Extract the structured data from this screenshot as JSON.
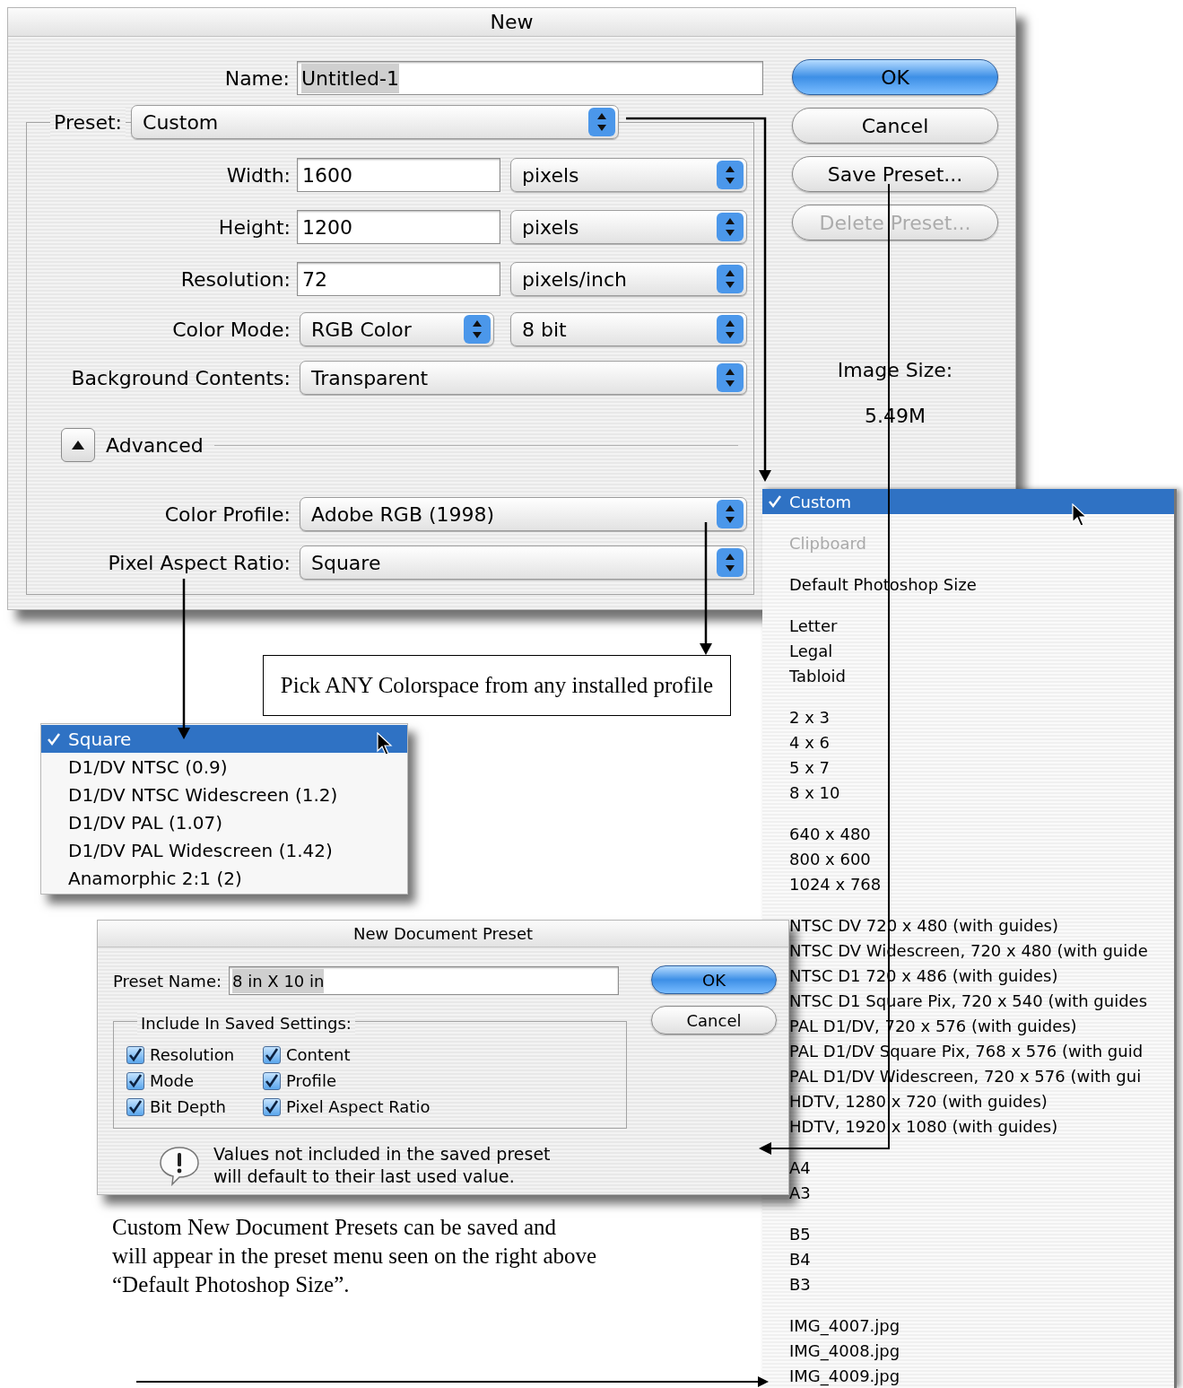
{
  "new_dialog": {
    "title": "New",
    "name": {
      "label": "Name:",
      "value": "Untitled-1",
      "selected": true
    },
    "preset": {
      "label": "Preset:",
      "value": "Custom"
    },
    "fields": [
      {
        "kind": "text",
        "label": "Width:",
        "value": "1600",
        "unit": "pixels"
      },
      {
        "kind": "text",
        "label": "Height:",
        "value": "1200",
        "unit": "pixels"
      },
      {
        "kind": "text",
        "label": "Resolution:",
        "value": "72",
        "unit": "pixels/inch"
      },
      {
        "kind": "popup_pair",
        "label": "Color Mode:",
        "value": "RGB Color",
        "unit": "8 bit"
      },
      {
        "kind": "popup",
        "label": "Background Contents:",
        "value": "Transparent"
      }
    ],
    "advanced": {
      "label": "Advanced",
      "expanded": true
    },
    "advanced_fields": [
      {
        "kind": "popup",
        "label": "Color Profile:",
        "value": "Adobe RGB (1998)"
      },
      {
        "kind": "popup",
        "label": "Pixel Aspect Ratio:",
        "value": "Square"
      }
    ],
    "buttons": [
      {
        "label": "OK",
        "default": true,
        "disabled": false
      },
      {
        "label": "Cancel",
        "default": false,
        "disabled": false
      },
      {
        "label": "Save Preset...",
        "default": false,
        "disabled": false
      },
      {
        "label": "Delete Preset...",
        "default": false,
        "disabled": true
      }
    ],
    "image_size": {
      "label": "Image Size:",
      "value": "5.49M"
    }
  },
  "preset_menu": {
    "groups": [
      [
        {
          "label": "Custom",
          "selected": true,
          "disabled": false
        }
      ],
      [
        {
          "label": "Clipboard",
          "selected": false,
          "disabled": true
        }
      ],
      [
        {
          "label": "Default Photoshop Size",
          "selected": false,
          "disabled": false
        }
      ],
      [
        {
          "label": "Letter",
          "selected": false,
          "disabled": false
        },
        {
          "label": "Legal",
          "selected": false,
          "disabled": false
        },
        {
          "label": "Tabloid",
          "selected": false,
          "disabled": false
        }
      ],
      [
        {
          "label": "2 x 3",
          "selected": false,
          "disabled": false
        },
        {
          "label": "4 x 6",
          "selected": false,
          "disabled": false
        },
        {
          "label": "5 x 7",
          "selected": false,
          "disabled": false
        },
        {
          "label": "8 x 10",
          "selected": false,
          "disabled": false
        }
      ],
      [
        {
          "label": "640 x 480",
          "selected": false,
          "disabled": false
        },
        {
          "label": "800 x 600",
          "selected": false,
          "disabled": false
        },
        {
          "label": "1024 x 768",
          "selected": false,
          "disabled": false
        }
      ],
      [
        {
          "label": "NTSC DV 720 x 480 (with guides)",
          "selected": false,
          "disabled": false
        },
        {
          "label": "NTSC DV Widescreen, 720 x 480 (with guide",
          "selected": false,
          "disabled": false
        },
        {
          "label": "NTSC D1 720 x 486 (with guides)",
          "selected": false,
          "disabled": false
        },
        {
          "label": "NTSC D1 Square Pix, 720 x 540 (with guides",
          "selected": false,
          "disabled": false
        },
        {
          "label": "PAL D1/DV, 720 x 576 (with guides)",
          "selected": false,
          "disabled": false
        },
        {
          "label": "PAL D1/DV Square Pix, 768 x 576 (with guid",
          "selected": false,
          "disabled": false
        },
        {
          "label": "PAL D1/DV Widescreen, 720 x 576 (with gui",
          "selected": false,
          "disabled": false
        },
        {
          "label": "HDTV, 1280 x 720 (with guides)",
          "selected": false,
          "disabled": false
        },
        {
          "label": "HDTV, 1920 x 1080 (with guides)",
          "selected": false,
          "disabled": false
        }
      ],
      [
        {
          "label": "A4",
          "selected": false,
          "disabled": false
        },
        {
          "label": "A3",
          "selected": false,
          "disabled": false
        }
      ],
      [
        {
          "label": "B5",
          "selected": false,
          "disabled": false
        },
        {
          "label": "B4",
          "selected": false,
          "disabled": false
        },
        {
          "label": "B3",
          "selected": false,
          "disabled": false
        }
      ],
      [
        {
          "label": "IMG_4007.jpg",
          "selected": false,
          "disabled": false
        },
        {
          "label": "IMG_4008.jpg",
          "selected": false,
          "disabled": false
        },
        {
          "label": "IMG_4009.jpg",
          "selected": false,
          "disabled": false
        }
      ]
    ]
  },
  "aspect_menu": {
    "items": [
      {
        "label": "Square",
        "selected": true
      },
      {
        "label": "D1/DV NTSC (0.9)",
        "selected": false
      },
      {
        "label": "D1/DV NTSC Widescreen (1.2)",
        "selected": false
      },
      {
        "label": "D1/DV PAL (1.07)",
        "selected": false
      },
      {
        "label": "D1/DV PAL Widescreen (1.42)",
        "selected": false
      },
      {
        "label": "Anamorphic 2:1 (2)",
        "selected": false
      }
    ]
  },
  "callout": "Pick ANY Colorspace from any installed profile",
  "preset_dialog": {
    "title": "New Document Preset",
    "preset_name": {
      "label": "Preset Name:",
      "value": "8 in X 10 in",
      "selected": true
    },
    "group_label": "Include In Saved Settings:",
    "checkboxes": [
      {
        "label": "Resolution",
        "checked": true
      },
      {
        "label": "Content",
        "checked": true
      },
      {
        "label": "Mode",
        "checked": true
      },
      {
        "label": "Profile",
        "checked": true
      },
      {
        "label": "Bit Depth",
        "checked": true
      },
      {
        "label": "Pixel Aspect Ratio",
        "checked": true
      }
    ],
    "note": "Values not included in the saved preset will default to their last used value.",
    "buttons": [
      {
        "label": "OK",
        "default": true,
        "disabled": false
      },
      {
        "label": "Cancel",
        "default": false,
        "disabled": false
      }
    ]
  },
  "caption": "Custom New Document Presets can be saved and\nwill appear in the preset menu seen on the right above\n“Default Photoshop Size”."
}
